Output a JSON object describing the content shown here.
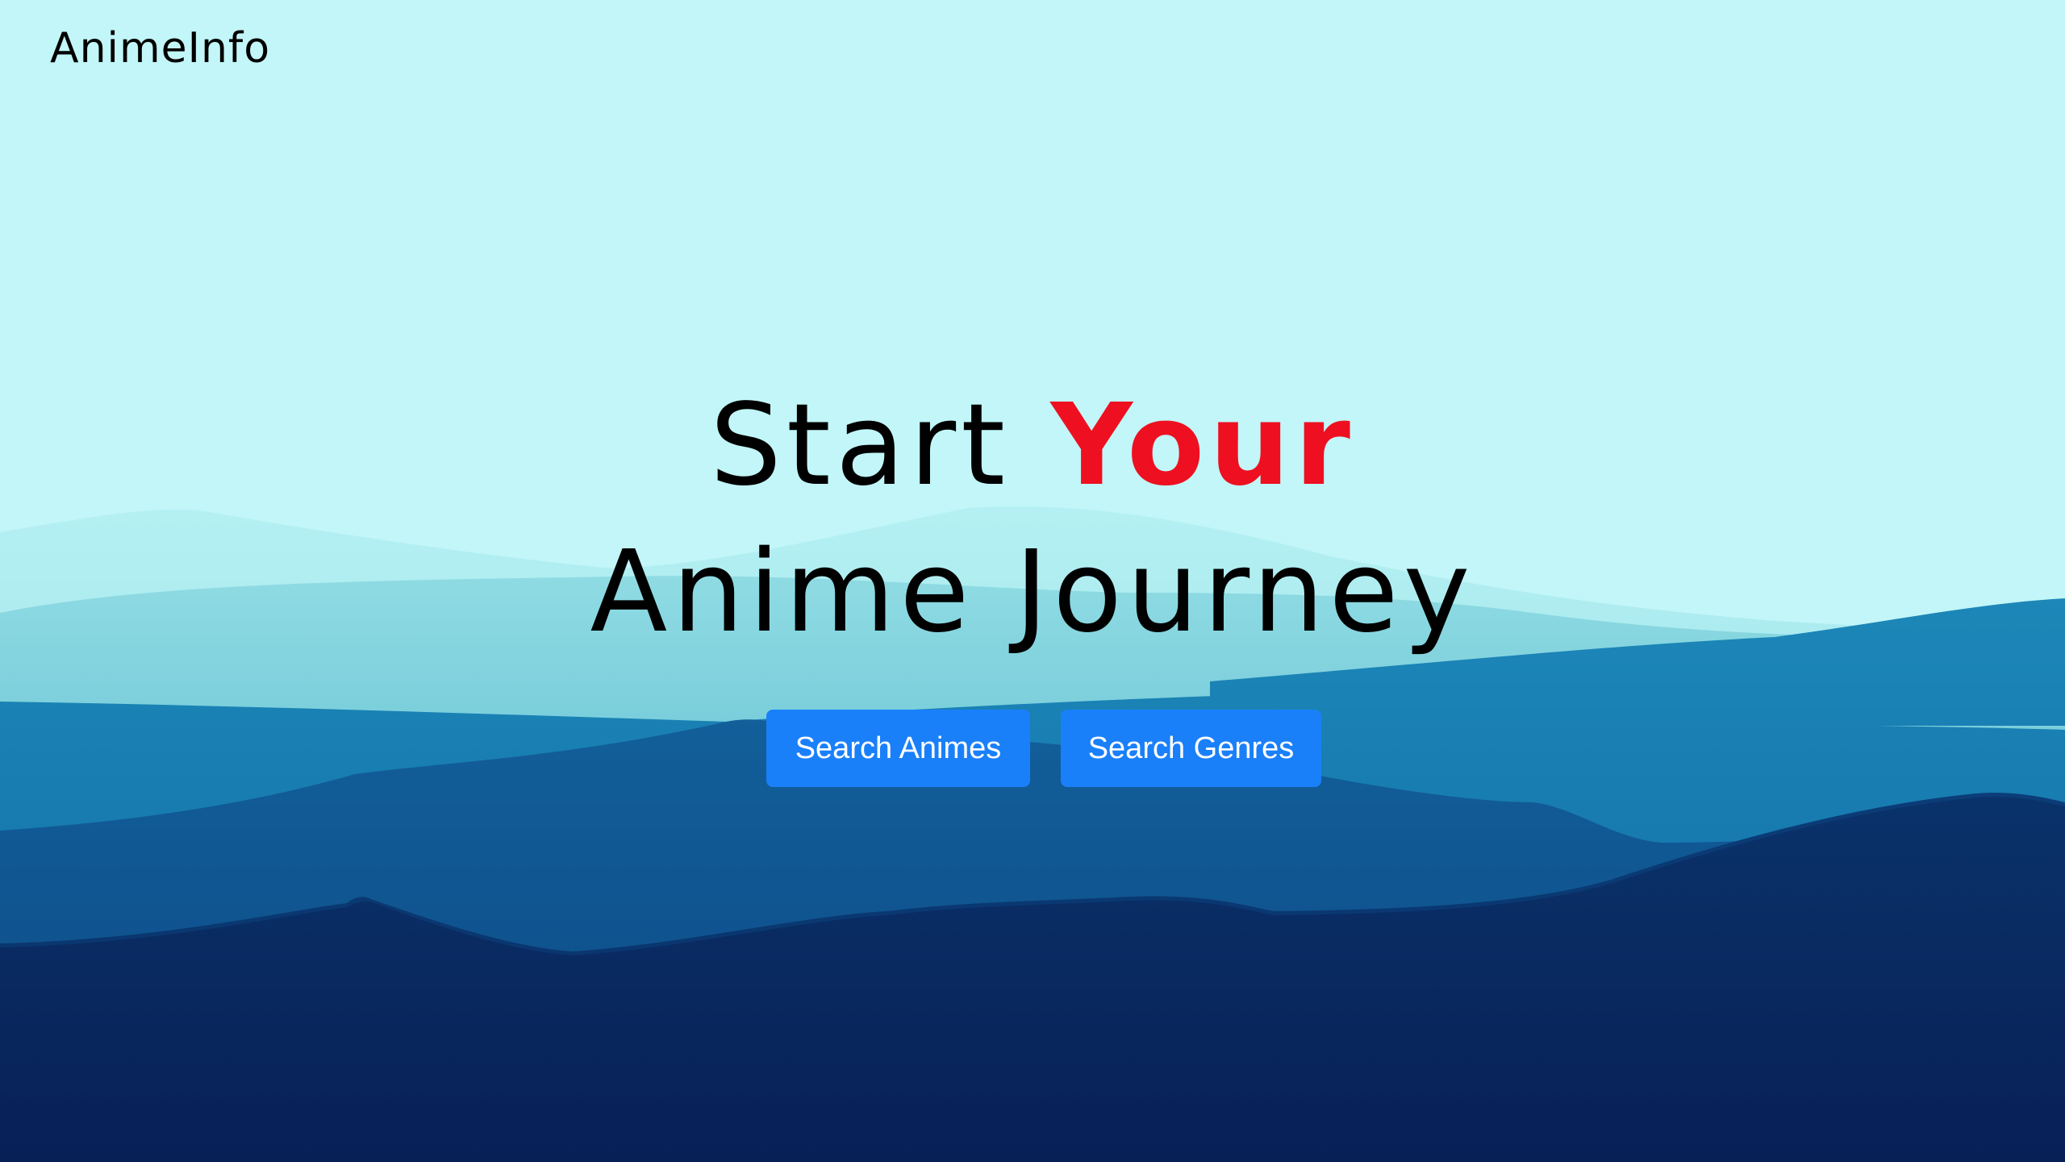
{
  "header": {
    "brand": "AnimeInfo"
  },
  "hero": {
    "title_start": "Start ",
    "title_accent": "Your",
    "title_rest": " Anime Journey",
    "accent_color": "#ee1020"
  },
  "actions": {
    "search_animes": "Search Animes",
    "search_genres": "Search Genres",
    "button_color": "#1a80fa"
  },
  "background": {
    "sky_color": "#c2f6f8",
    "deep_color": "#06144a"
  }
}
